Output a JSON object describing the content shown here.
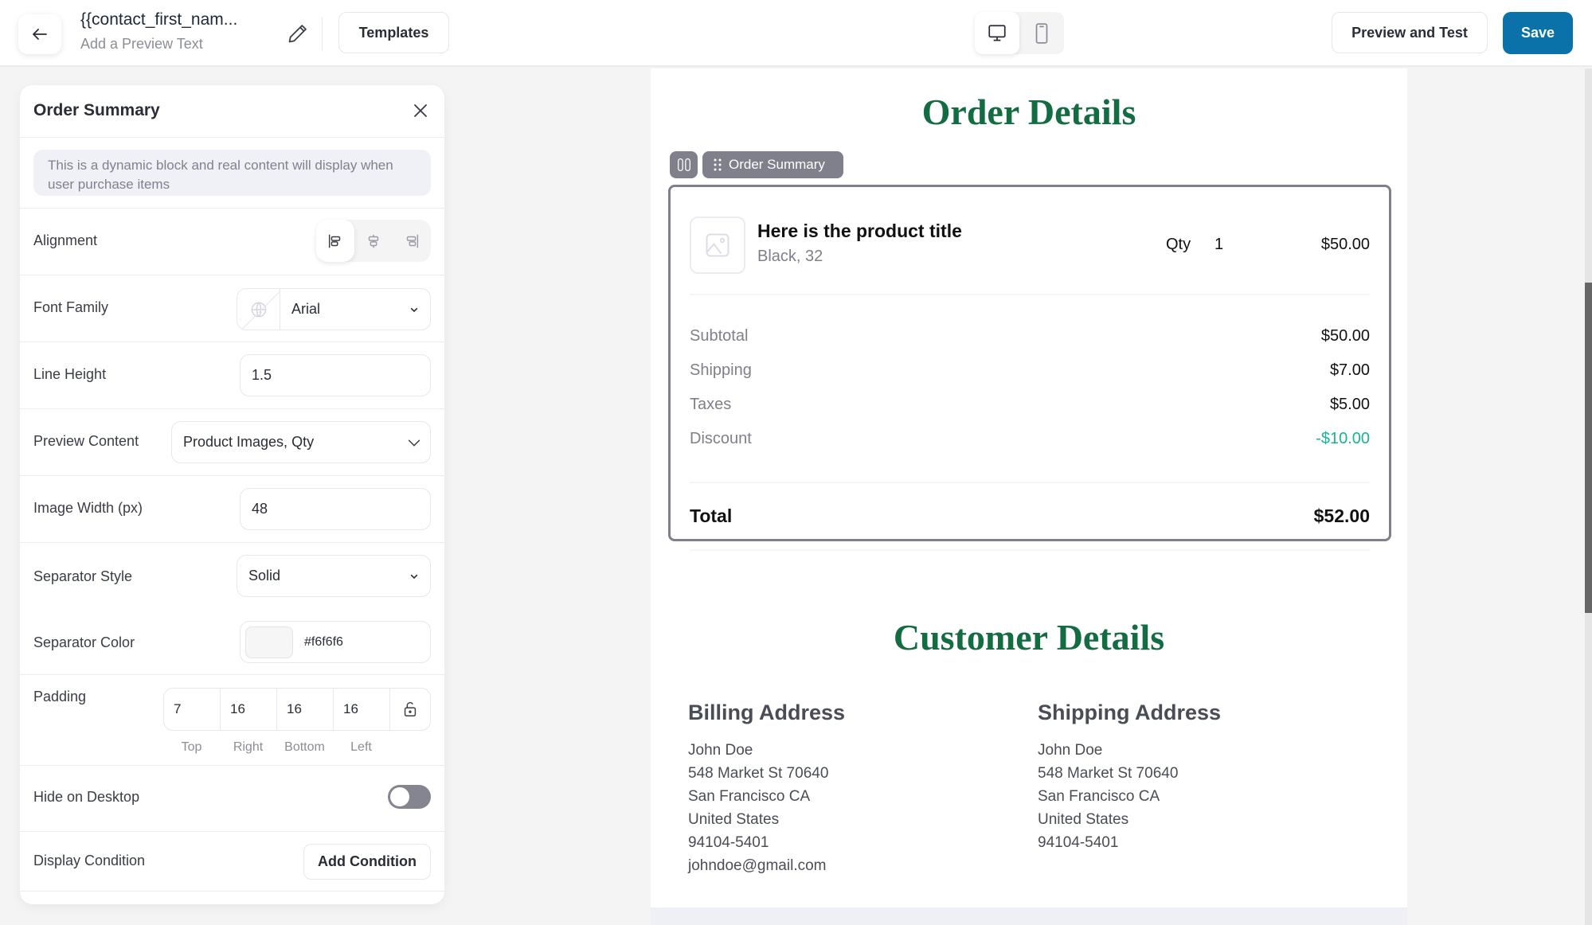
{
  "header": {
    "title": "{{contact_first_nam...",
    "subtitle": "Add a Preview Text",
    "templates_label": "Templates",
    "preview_label": "Preview and Test",
    "save_label": "Save",
    "device_modes": [
      "desktop",
      "mobile"
    ],
    "active_device": "desktop",
    "accent_color": "#0a72a9"
  },
  "panel": {
    "title": "Order Summary",
    "info": "This is a dynamic block and real content will display when user purchase items",
    "alignment": {
      "label": "Alignment",
      "options": [
        "left",
        "center",
        "right"
      ],
      "selected": "left"
    },
    "font_family": {
      "label": "Font Family",
      "value": "Arial"
    },
    "line_height": {
      "label": "Line Height",
      "value": "1.5"
    },
    "preview_content": {
      "label": "Preview Content",
      "value": "Product Images, Qty"
    },
    "image_width": {
      "label": "Image Width (px)",
      "value": "48"
    },
    "separator_style": {
      "label": "Separator Style",
      "value": "Solid"
    },
    "separator_color": {
      "label": "Separator Color",
      "value": "#f6f6f6"
    },
    "padding": {
      "label": "Padding",
      "top": "7",
      "right": "16",
      "bottom": "16",
      "left": "16",
      "labels": {
        "top": "Top",
        "right": "Right",
        "bottom": "Bottom",
        "left": "Left"
      }
    },
    "hide_desktop": {
      "label": "Hide on Desktop",
      "on": false
    },
    "display_condition": {
      "label": "Display Condition",
      "button": "Add Condition"
    }
  },
  "canvas": {
    "order_heading": "Order Details",
    "block_tag": "Order Summary",
    "product": {
      "title": "Here is the product title",
      "variant": "Black, 32",
      "qty_label": "Qty",
      "qty": "1",
      "price": "$50.00"
    },
    "summary": [
      {
        "label": "Subtotal",
        "value": "$50.00"
      },
      {
        "label": "Shipping",
        "value": "$7.00"
      },
      {
        "label": "Taxes",
        "value": "$5.00"
      },
      {
        "label": "Discount",
        "value": "-$10.00"
      }
    ],
    "total": {
      "label": "Total",
      "value": "$52.00"
    },
    "customer_heading": "Customer Details",
    "billing": {
      "heading": "Billing Address",
      "lines": [
        "John Doe",
        "548 Market St 70640",
        "San Francisco CA",
        "United States",
        "94104-5401",
        "johndoe@gmail.com"
      ]
    },
    "shipping": {
      "heading": "Shipping Address",
      "lines": [
        "John Doe",
        "548 Market St 70640",
        "San Francisco CA",
        "United States",
        "94104-5401"
      ]
    },
    "heading_color": "#146c43",
    "discount_color": "#1ab394"
  }
}
